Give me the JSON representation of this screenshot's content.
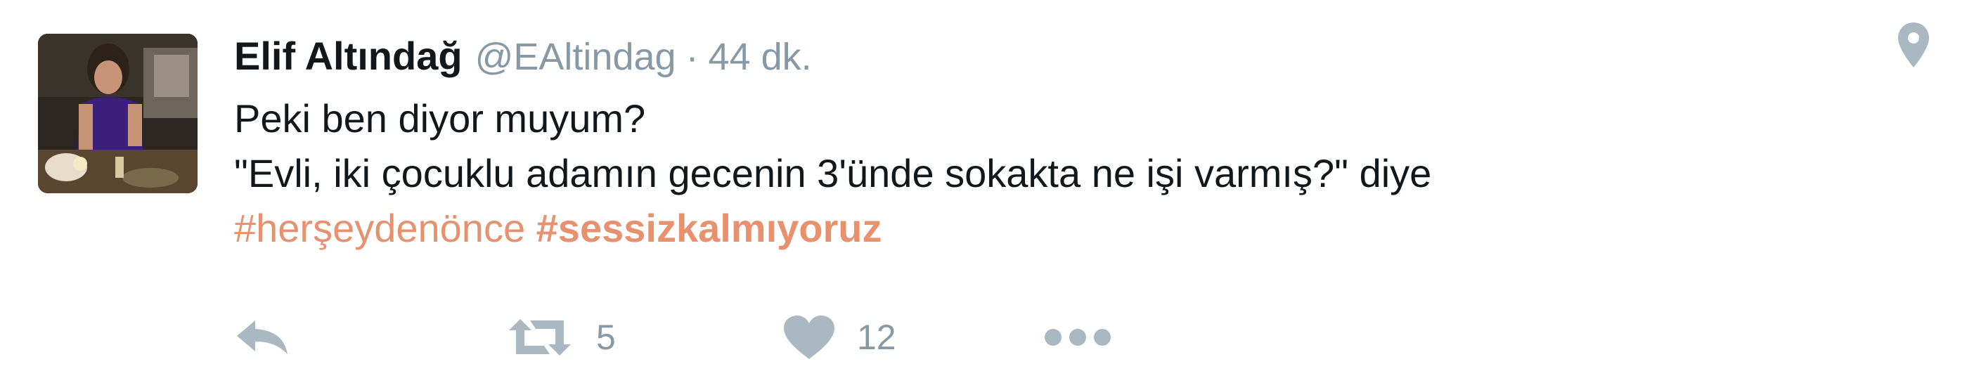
{
  "tweet": {
    "author_name": "Elif Altındağ",
    "handle": "@EAltindag",
    "separator": "·",
    "time": "44 dk.",
    "lines": [
      "Peki ben diyor muyum?",
      "\"Evli, iki çocuklu adamın gecenin 3'ünde sokakta ne işi varmış?\" diye"
    ],
    "hashtags": [
      "#herşeydenönce",
      "#sessizkalmıyoruz"
    ]
  },
  "actions": {
    "retweet_count": "5",
    "like_count": "12"
  },
  "icons": {
    "location": "map-pin-icon",
    "reply": "reply-icon",
    "retweet": "retweet-icon",
    "like": "heart-icon",
    "more": "more-dots-icon"
  },
  "colors": {
    "text": "#14171a",
    "muted": "#8899a6",
    "hashtag": "#e8916f",
    "icon": "#aab8c2"
  }
}
